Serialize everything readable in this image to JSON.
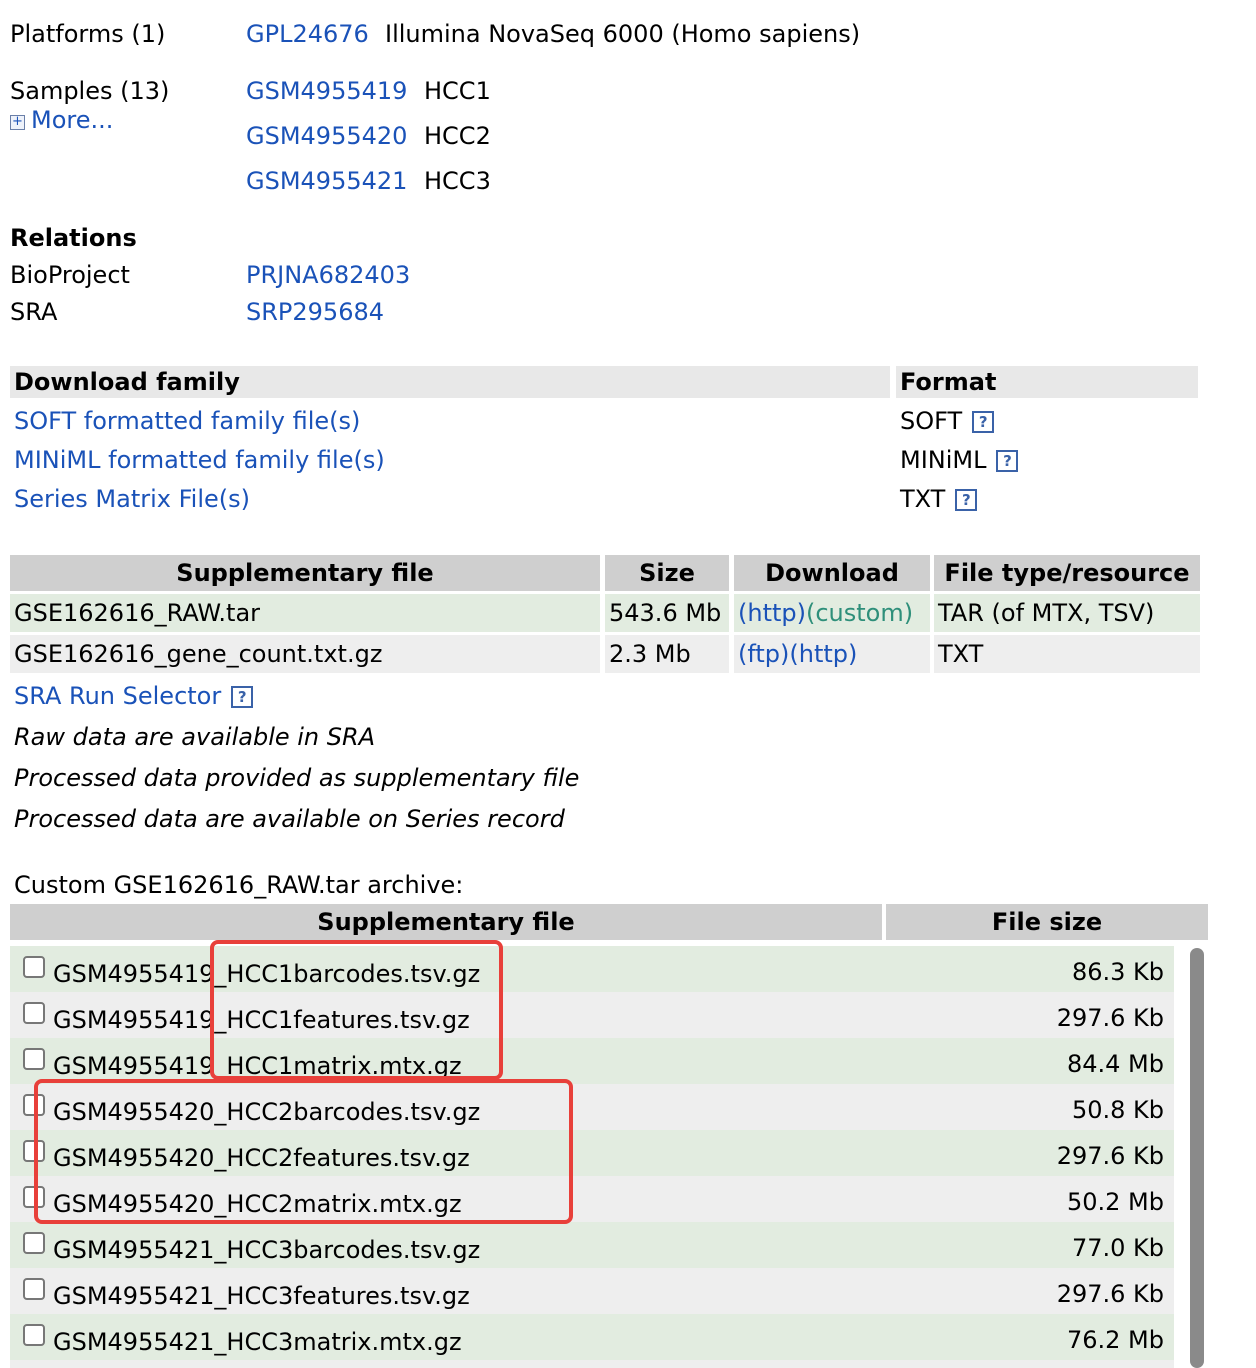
{
  "platforms": {
    "label": "Platforms (1)",
    "items": [
      {
        "id": "GPL24676",
        "desc": "Illumina NovaSeq 6000 (Homo sapiens)"
      }
    ]
  },
  "samples": {
    "label": "Samples (13)",
    "more_label": "More...",
    "items": [
      {
        "id": "GSM4955419",
        "name": "HCC1"
      },
      {
        "id": "GSM4955420",
        "name": "HCC2"
      },
      {
        "id": "GSM4955421",
        "name": "HCC3"
      }
    ]
  },
  "relations": {
    "title": "Relations",
    "items": [
      {
        "label": "BioProject",
        "value": "PRJNA682403"
      },
      {
        "label": "SRA",
        "value": "SRP295684"
      }
    ]
  },
  "download_family": {
    "header_left": "Download family",
    "header_right": "Format",
    "rows": [
      {
        "label": "SOFT formatted family file(s)",
        "format": "SOFT"
      },
      {
        "label": "MINiML formatted family file(s)",
        "format": "MINiML"
      },
      {
        "label": "Series Matrix File(s)",
        "format": "TXT"
      }
    ],
    "help_glyph": "?"
  },
  "supplementary": {
    "headers": [
      "Supplementary file",
      "Size",
      "Download",
      "File type/resource"
    ],
    "rows": [
      {
        "file": "GSE162616_RAW.tar",
        "size": "543.6 Mb",
        "dl1": "(http)",
        "dl2": "(custom)",
        "type": "TAR (of MTX, TSV)"
      },
      {
        "file": "GSE162616_gene_count.txt.gz",
        "size": "2.3 Mb",
        "dl1": "(ftp)",
        "dl2": "(http)",
        "type": "TXT"
      }
    ],
    "sra_selector": "SRA Run Selector",
    "notes": [
      "Raw data are available in SRA",
      "Processed data provided as supplementary file",
      "Processed data are available on Series record"
    ]
  },
  "archive": {
    "caption": "Custom GSE162616_RAW.tar archive:",
    "header_file": "Supplementary file",
    "header_size": "File size",
    "rows": [
      {
        "file": "GSM4955419_HCC1barcodes.tsv.gz",
        "size": "86.3 Kb"
      },
      {
        "file": "GSM4955419_HCC1features.tsv.gz",
        "size": "297.6 Kb"
      },
      {
        "file": "GSM4955419_HCC1matrix.mtx.gz",
        "size": "84.4 Mb"
      },
      {
        "file": "GSM4955420_HCC2barcodes.tsv.gz",
        "size": "50.8 Kb"
      },
      {
        "file": "GSM4955420_HCC2features.tsv.gz",
        "size": "297.6 Kb"
      },
      {
        "file": "GSM4955420_HCC2matrix.mtx.gz",
        "size": "50.2 Mb"
      },
      {
        "file": "GSM4955421_HCC3barcodes.tsv.gz",
        "size": "77.0 Kb"
      },
      {
        "file": "GSM4955421_HCC3features.tsv.gz",
        "size": "297.6 Kb"
      },
      {
        "file": "GSM4955421_HCC3matrix.mtx.gz",
        "size": "76.2 Mb"
      }
    ]
  },
  "colors": {
    "link": "#1a52b8",
    "custom_link": "#2e8f7a",
    "highlight": "#e8403a",
    "row_green": "#e2ece0",
    "row_grey": "#eeeeee",
    "header_dark": "#cfcfcf"
  }
}
